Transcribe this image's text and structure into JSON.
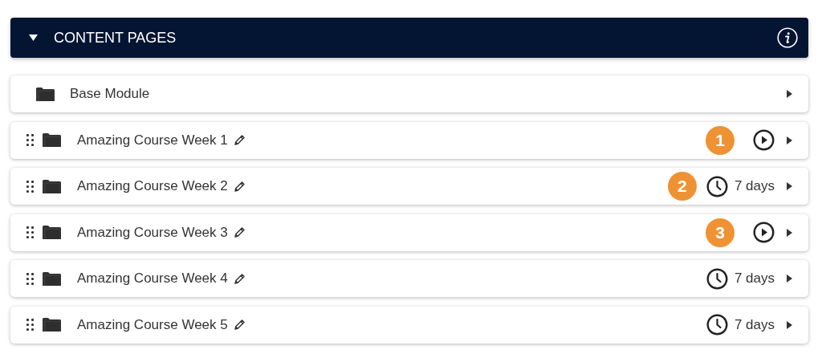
{
  "header": {
    "title": "CONTENT PAGES",
    "expanded": true
  },
  "modules": [
    {
      "title": "Base Module",
      "draggable": false,
      "editable": false
    },
    {
      "title": "Amazing Course Week 1",
      "draggable": true,
      "editable": true,
      "badge": "1",
      "kind": "play"
    },
    {
      "title": "Amazing Course Week 2",
      "draggable": true,
      "editable": true,
      "badge": "2",
      "kind": "timer",
      "duration": "7 days"
    },
    {
      "title": "Amazing Course Week 3",
      "draggable": true,
      "editable": true,
      "badge": "3",
      "kind": "play"
    },
    {
      "title": "Amazing Course Week 4",
      "draggable": true,
      "editable": true,
      "kind": "timer",
      "duration": "7 days"
    },
    {
      "title": "Amazing Course Week 5",
      "draggable": true,
      "editable": true,
      "kind": "timer",
      "duration": "7 days"
    }
  ]
}
